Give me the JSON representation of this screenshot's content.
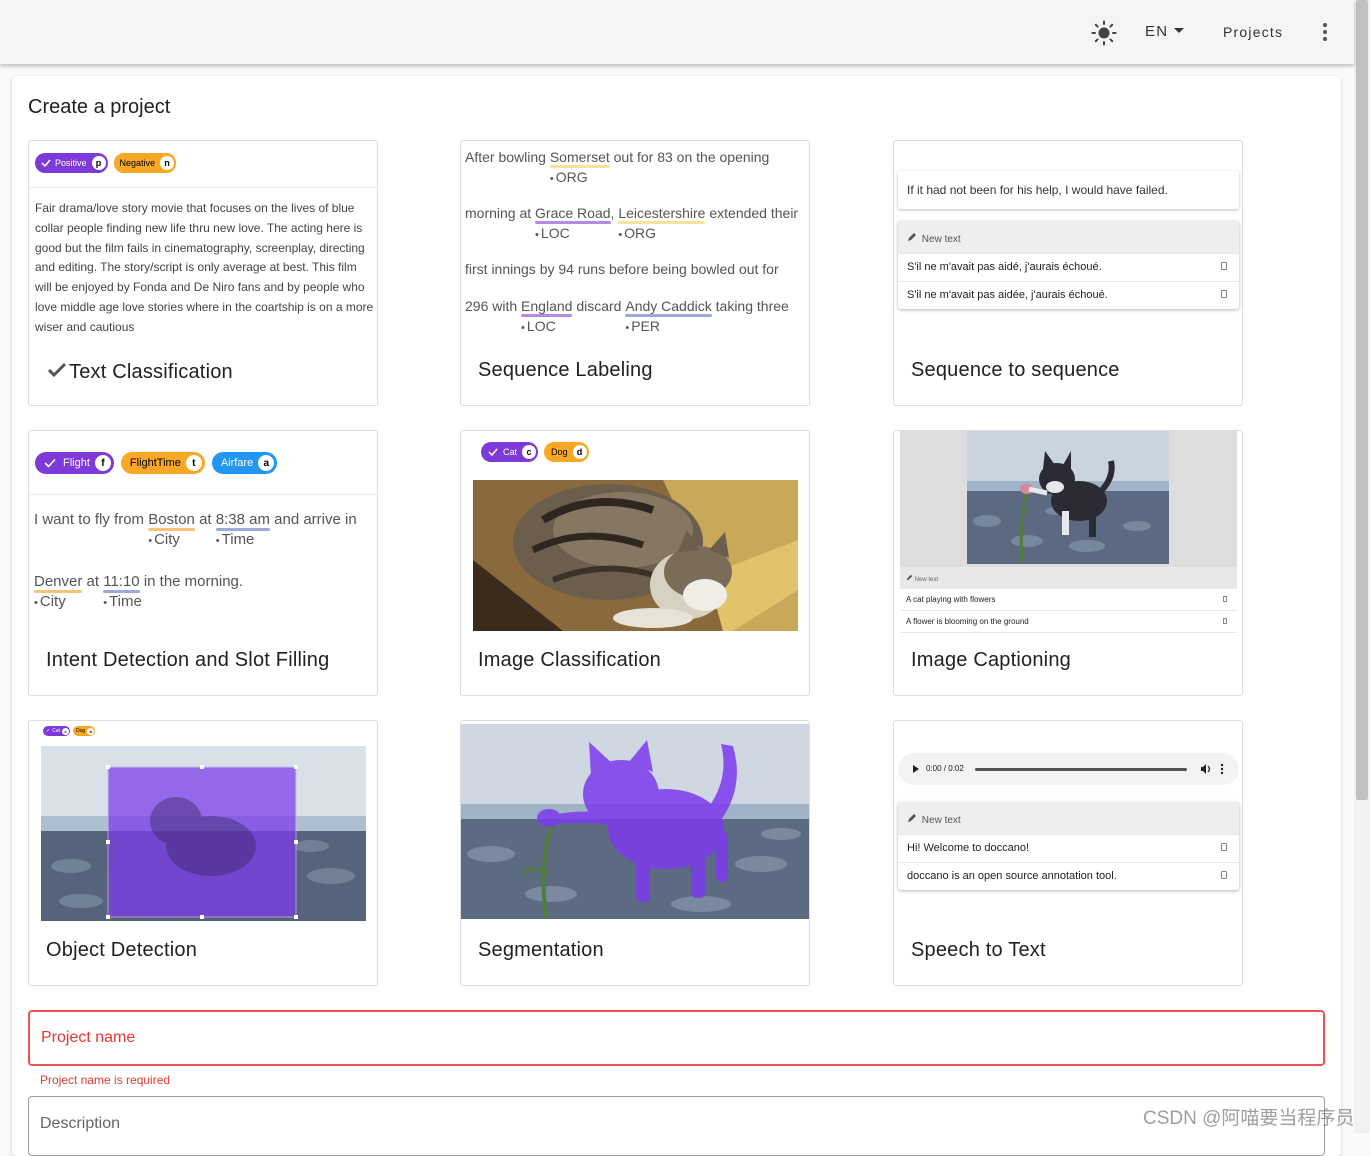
{
  "appbar": {
    "language": "EN",
    "projects_label": "Projects"
  },
  "page": {
    "title": "Create a project"
  },
  "cards": {
    "text_classification": {
      "title": "Text Classification",
      "chips": [
        {
          "label": "Positive",
          "key": "p"
        },
        {
          "label": "Negative",
          "key": "n"
        }
      ],
      "text": "Fair drama/love story movie that focuses on the lives of blue collar people finding new life thru new love. The acting here is good but the film fails in cinematography, screenplay, directing and editing. The story/script is only average at best. This film will be enjoyed by Fonda and De Niro fans and by people who love middle age love stories where in the coartship is on a more wiser and cautious"
    },
    "sequence_labeling": {
      "title": "Sequence Labeling",
      "l1": {
        "a": "After bowling ",
        "e1": "Somerset",
        "t1": "ORG",
        "b": " out for 83 on the opening"
      },
      "l2": {
        "a": "morning at ",
        "e1": "Grace Road",
        "t1": "LOC",
        "b": ", ",
        "e2": "Leicestershire",
        "t2": "ORG",
        "c": " extended their"
      },
      "l3": "first innings by 94 runs before being bowled out for",
      "l4": {
        "a": "296 with ",
        "e1": "England",
        "t1": "LOC",
        "b": " discard ",
        "e2": "Andy Caddick",
        "t2": "PER",
        "c": " taking three"
      }
    },
    "seq2seq": {
      "title": "Sequence to sequence",
      "source": "If it had not been for his help, I would have failed.",
      "new_text": "New text",
      "rows": [
        "S'il ne m'avait pas aidé, j'aurais échoué.",
        "S'il ne m'avait pas aidée, j'aurais échoué."
      ]
    },
    "intent": {
      "title": "Intent Detection and Slot Filling",
      "chips": [
        {
          "label": "Flight",
          "key": "f"
        },
        {
          "label": "FlightTime",
          "key": "t"
        },
        {
          "label": "Airfare",
          "key": "a"
        }
      ],
      "l1": {
        "a": "I want to fly from ",
        "e1": "Boston",
        "t1": "City",
        "b": " at ",
        "e2": "8:38 am",
        "t2": "Time",
        "c": " and arrive in"
      },
      "l2": {
        "e1": "Denver",
        "t1": "City",
        "a": " at ",
        "e2": "11:10",
        "t2": "Time",
        "b": " in the morning."
      }
    },
    "image_classification": {
      "title": "Image Classification",
      "chips": [
        {
          "label": "Cat",
          "key": "c"
        },
        {
          "label": "Dog",
          "key": "d"
        }
      ]
    },
    "image_captioning": {
      "title": "Image Captioning",
      "new_text": "New text",
      "rows": [
        "A cat playing with flowers",
        "A flower is blooming on the ground"
      ]
    },
    "object_detection": {
      "title": "Object Detection",
      "chips": [
        {
          "label": "Cat",
          "key": "c"
        },
        {
          "label": "Dog",
          "key": "d"
        }
      ]
    },
    "segmentation": {
      "title": "Segmentation"
    },
    "speech_to_text": {
      "title": "Speech to Text",
      "time": "0:00 / 0:02",
      "new_text": "New text",
      "rows": [
        "Hi! Welcome to doccano!",
        "doccano is an open source annotation tool."
      ]
    }
  },
  "form": {
    "project_name_label": "Project name",
    "project_name_error": "Project name is required",
    "description_label": "Description"
  },
  "watermark": "CSDN @阿喵要当程序员"
}
